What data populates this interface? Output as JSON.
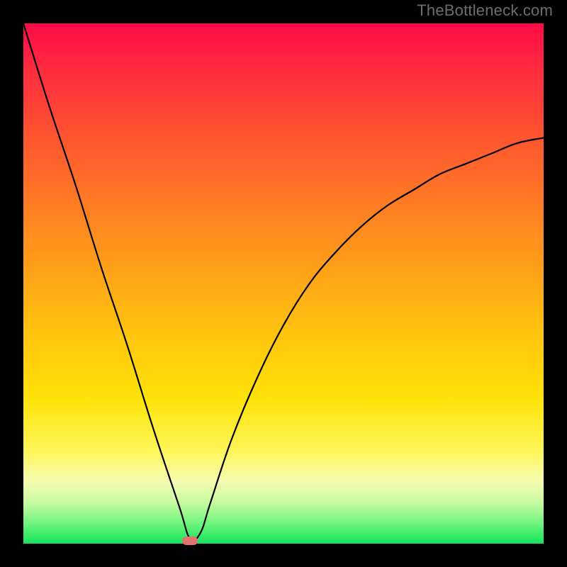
{
  "watermark": "TheBottleneck.com",
  "chart_data": {
    "type": "line",
    "title": "",
    "xlabel": "",
    "ylabel": "",
    "xlim": [
      0,
      100
    ],
    "ylim": [
      0,
      100
    ],
    "grid": false,
    "legend": false,
    "background_gradient": {
      "stops": [
        {
          "pos": 0.0,
          "color": "#ff0b47"
        },
        {
          "pos": 0.5,
          "color": "#ffa318"
        },
        {
          "pos": 0.82,
          "color": "#fef657"
        },
        {
          "pos": 1.0,
          "color": "#14e35d"
        }
      ],
      "direction": "top-to-bottom"
    },
    "series": [
      {
        "name": "bottleneck-curve",
        "x": [
          0,
          5,
          10,
          15,
          20,
          25,
          30,
          32,
          34,
          36,
          40,
          45,
          50,
          55,
          60,
          65,
          70,
          75,
          80,
          85,
          90,
          95,
          100
        ],
        "values": [
          100,
          84,
          69,
          53,
          38,
          22,
          7,
          1,
          2,
          8,
          20,
          32,
          42,
          50,
          56,
          61,
          65,
          68,
          71,
          73,
          75,
          77,
          78
        ]
      }
    ],
    "markers": [
      {
        "name": "optimal-point",
        "x": 32,
        "y": 0.5,
        "color": "#e4736e"
      }
    ]
  }
}
